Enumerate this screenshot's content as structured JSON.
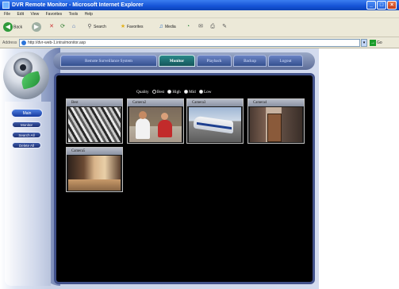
{
  "window": {
    "title": "DVR Remote Monitor - Microsoft Internet Explorer",
    "controls": {
      "minimize": "_",
      "maximize": "□",
      "close": "×"
    }
  },
  "menubar": [
    "File",
    "Edit",
    "View",
    "Favorites",
    "Tools",
    "Help"
  ],
  "toolbar": {
    "back": "Back",
    "search": "Search",
    "favorites": "Favorites",
    "media": "Media"
  },
  "addressbar": {
    "label": "Address",
    "url": "http://dvr-web-1.intra/monitor.asp",
    "go": "Go",
    "go_arrow": "→"
  },
  "app": {
    "tabs": [
      {
        "label": "Remote Surveillance System",
        "active": false
      },
      {
        "label": "Monitor",
        "active": true
      },
      {
        "label": "Playback",
        "active": false
      },
      {
        "label": "Backup",
        "active": false
      },
      {
        "label": "Logout",
        "active": false
      }
    ],
    "side_buttons": {
      "main": "Main",
      "items": [
        "Monitor",
        "Search All",
        "Delete All"
      ]
    },
    "quality": {
      "label": "Quality",
      "options": [
        "Best",
        "High",
        "Mid",
        "Low"
      ],
      "selected": "Best"
    },
    "cameras": [
      {
        "label": "Best"
      },
      {
        "label": "Camera2"
      },
      {
        "label": "Camera3"
      },
      {
        "label": "Camera4"
      },
      {
        "label": "Camera5"
      }
    ]
  }
}
